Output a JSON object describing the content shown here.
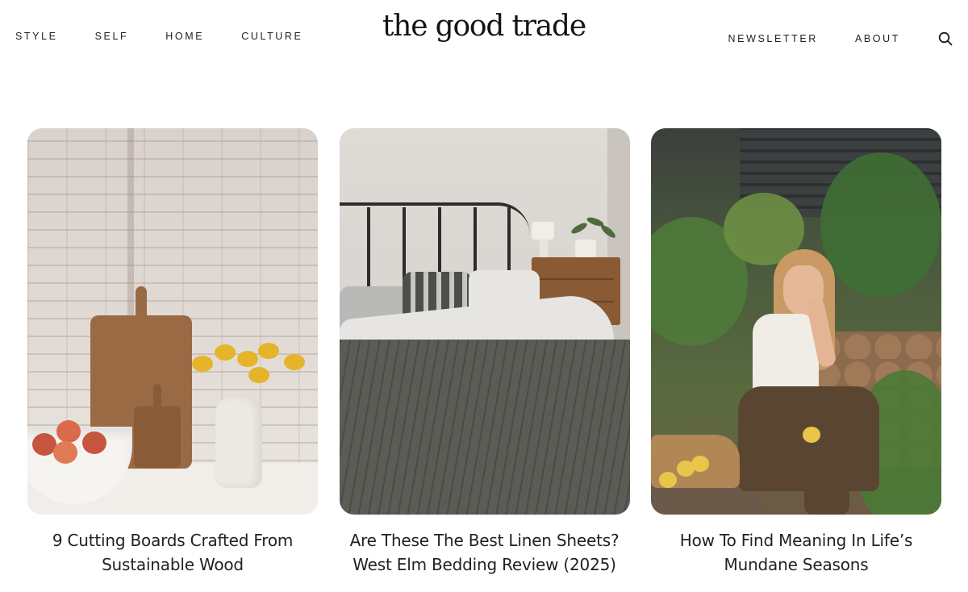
{
  "header": {
    "logo": "the good trade",
    "nav_left": [
      {
        "label": "STYLE"
      },
      {
        "label": "SELF"
      },
      {
        "label": "HOME"
      },
      {
        "label": "CULTURE"
      }
    ],
    "nav_right": [
      {
        "label": "NEWSLETTER"
      },
      {
        "label": "ABOUT"
      }
    ],
    "search_icon": "search-icon"
  },
  "articles": [
    {
      "title_line1": "9 Cutting Boards Crafted From",
      "title_line2": "Sustainable Wood",
      "image": "kitchen-cutting-boards"
    },
    {
      "title_line1": "Are These The Best Linen Sheets?",
      "title_line2": "West Elm Bedding Review (2025)",
      "image": "bedroom-linen-bedding"
    },
    {
      "title_line1": "How To Find Meaning In Life’s",
      "title_line2": "Mundane Seasons",
      "image": "woman-in-garden"
    }
  ]
}
